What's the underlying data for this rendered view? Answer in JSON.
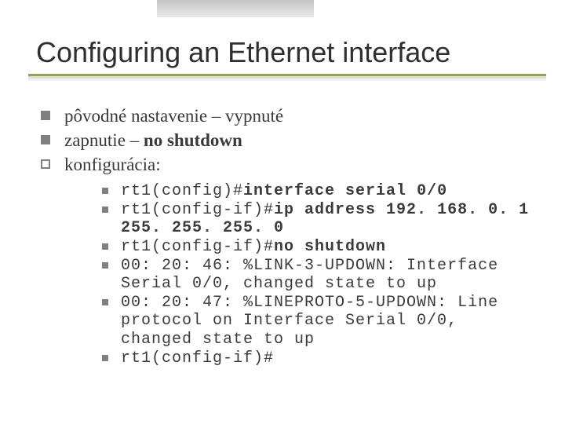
{
  "title": "Configuring an Ethernet interface",
  "bullets": {
    "b1_pre": "pôvodné nastavenie – vypnuté",
    "b2_pre": "zapnutie – ",
    "b2_bold": "no shutdown",
    "b3_pre": "konfigurácia:"
  },
  "code": {
    "l1_p": "rt1(config)#",
    "l1_b": "interface serial 0/0",
    "l2_p": "rt1(config-if)#",
    "l2_b": "ip address 192. 168. 0. 1 255. 255. 255. 0",
    "l3_p": "rt1(config-if)#",
    "l3_b": "no shutdown",
    "l4": "00: 20: 46: %LINK-3-UPDOWN: Interface Serial 0/0, changed state to up",
    "l5": "00: 20: 47: %LINEPROTO-5-UPDOWN: Line protocol on Interface Serial 0/0, changed state to up",
    "l6": "rt1(config-if)#"
  }
}
